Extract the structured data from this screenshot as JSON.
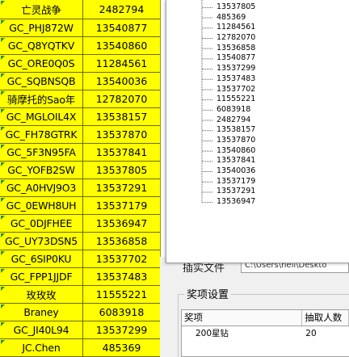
{
  "sheet": {
    "rows": [
      {
        "name": "亡灵战争",
        "id": "2482794"
      },
      {
        "name": "GC_PHJ872W",
        "id": "13540877"
      },
      {
        "name": "GC_Q8YQTKV",
        "id": "13540860"
      },
      {
        "name": "GC_ORE0Q0S",
        "id": "11284561"
      },
      {
        "name": "GC_SQBNSQB",
        "id": "13540036"
      },
      {
        "name": "骑摩托的Sao年",
        "id": "12782070"
      },
      {
        "name": "GC_MGLOIL4X",
        "id": "13538157"
      },
      {
        "name": "GC_FH78GTRK",
        "id": "13537870"
      },
      {
        "name": "GC_5F3N95FA",
        "id": "13537841"
      },
      {
        "name": "GC_YOFB2SW",
        "id": "13537805"
      },
      {
        "name": "GC_A0HVJ9O3",
        "id": "13537291"
      },
      {
        "name": "GC_0EWH8UH",
        "id": "13537179"
      },
      {
        "name": "GC_0DJFHEE",
        "id": "13536947"
      },
      {
        "name": "GC_UY73DSN5",
        "id": "13536858"
      },
      {
        "name": "GC_6SIP0KU",
        "id": "13537702"
      },
      {
        "name": "GC_FPP1JJDF",
        "id": "13537483"
      },
      {
        "name": "玫玫玫",
        "id": "11555221"
      },
      {
        "name": "Braney",
        "id": "6083918"
      },
      {
        "name": "GC_JI40L94",
        "id": "13537299"
      },
      {
        "name": "JC.Chen",
        "id": "485369"
      }
    ]
  },
  "list_window": {
    "items": [
      "13537805",
      "485369",
      "11284561",
      "12782070",
      "13536858",
      "13540877",
      "13537299",
      "13537483",
      "13537702",
      "11555221",
      "6083918",
      "2482794",
      "13538157",
      "13537870",
      "13540860",
      "13537841",
      "13540036",
      "13537179",
      "13537291",
      "13536947"
    ]
  },
  "dialog": {
    "import_label": "插实文件",
    "path_value": "C:\\Users\\hell\\Deskto",
    "group_title": "奖项设置",
    "columns": [
      "奖项",
      "抽取人数"
    ],
    "rows": [
      {
        "prize": "200星钻",
        "count": "20"
      }
    ]
  },
  "colors": {
    "sheet_bg": "#ffff00",
    "grid_line": "#6b6b00",
    "dialog_bg": "#f0f0f0"
  }
}
